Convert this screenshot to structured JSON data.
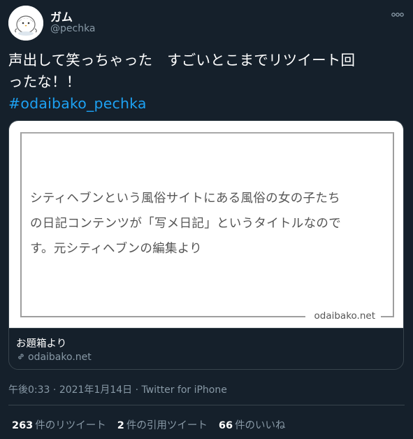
{
  "user": {
    "display_name": "ガム",
    "handle": "@pechka",
    "avatar_icon": "penguin-avatar"
  },
  "more_icon": "more-icon",
  "tweet": {
    "text_line1": "声出して笑っちゃった　すごいとこまでリツイート回",
    "text_line2": "ったな！！",
    "hashtag": "#odaibako_pechka"
  },
  "card": {
    "quote_line1": "シティヘブンという風俗サイトにある風俗の女の子たち",
    "quote_line2": "の日記コンテンツが「写メ日記」というタイトルなので",
    "quote_line3": "す。元シティヘブンの編集より",
    "watermark": "odaibako.net",
    "title": "お題箱より",
    "domain": "odaibako.net",
    "link_icon": "link-icon"
  },
  "meta": {
    "time": "午後0:33",
    "separator": " · ",
    "date": "2021年1月14日",
    "source": "Twitter for iPhone"
  },
  "stats": {
    "retweets_count": "263",
    "retweets_label": "件のリツイート",
    "quotes_count": "2",
    "quotes_label": "件の引用ツイート",
    "likes_count": "66",
    "likes_label": "件のいいね"
  },
  "colors": {
    "background": "#15202b",
    "accent": "#1da1f2",
    "secondary_text": "#8899a6",
    "border": "#38444d"
  }
}
